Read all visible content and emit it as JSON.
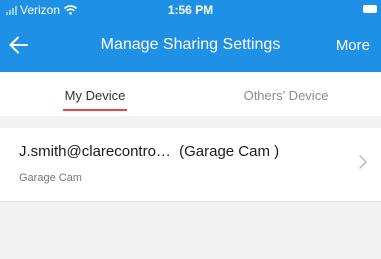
{
  "status_bar": {
    "carrier": "Verizon",
    "time": "1:56 PM"
  },
  "nav": {
    "title": "Manage Sharing Settings",
    "more_label": "More"
  },
  "tabs": [
    {
      "label": "My Device",
      "active": true
    },
    {
      "label": "Others' Device",
      "active": false
    }
  ],
  "devices": [
    {
      "owner": "J.smith@clarecontro…",
      "name_in_parens": "(Garage Cam )",
      "subtitle": "Garage Cam"
    }
  ],
  "colors": {
    "header_bg": "#1e90e6",
    "tab_indicator": "#e8434a",
    "page_bg": "#f2f2f2"
  },
  "icons": {
    "back": "arrow-left-icon",
    "chevron": "chevron-right-icon",
    "wifi": "wifi-icon",
    "signal": "signal-icon",
    "battery": "battery-icon"
  }
}
